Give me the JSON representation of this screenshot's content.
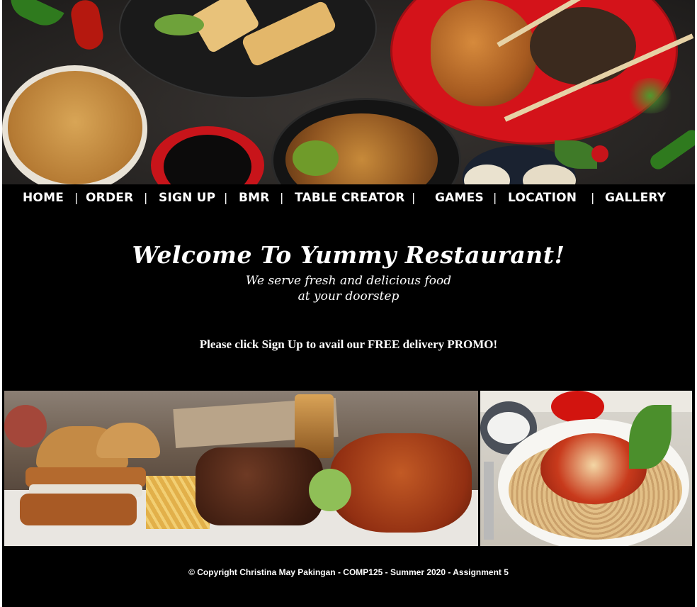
{
  "nav": {
    "items": [
      "HOME",
      "ORDER",
      "SIGN UP",
      "BMR",
      "TABLE CREATOR",
      "GAMES",
      "LOCATION",
      "GALLERY"
    ],
    "separator": "|"
  },
  "hero": {
    "title": "Welcome To Yummy Restaurant!",
    "subtitle_line1": "We serve fresh and delicious food",
    "subtitle_line2": "at your doorstep"
  },
  "promo": "Please click Sign Up to avail our FREE delivery PROMO!",
  "footer": "© Copyright Christina May Pakingan - COMP125 - Summer 2020 - Assignment 5",
  "colors": {
    "page_bg": "#000000",
    "text": "#ffffff"
  }
}
